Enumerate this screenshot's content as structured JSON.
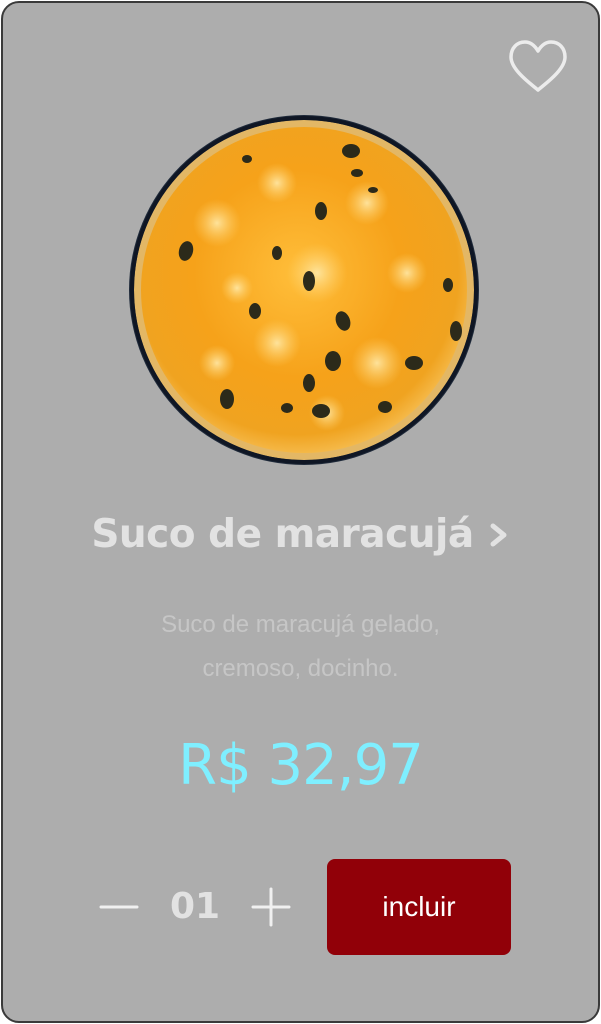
{
  "product": {
    "name": "Suco de maracujá",
    "description_line1": "Suco de maracujá gelado,",
    "description_line2": "cremoso, docinho.",
    "price": "R$ 32,97",
    "image_icon": "passion-fruit-juice-glass-top-view",
    "favorite_icon": "heart-outline-icon"
  },
  "quantity": {
    "value": "01",
    "decrement_icon": "minus-icon",
    "increment_icon": "plus-icon"
  },
  "actions": {
    "add_label": "incluir"
  },
  "colors": {
    "card_background": "#adadad",
    "title": "#e2e2e2",
    "description": "#c6c6c6",
    "price": "#7fefff",
    "button": "#910008",
    "button_text": "#ffffff"
  }
}
